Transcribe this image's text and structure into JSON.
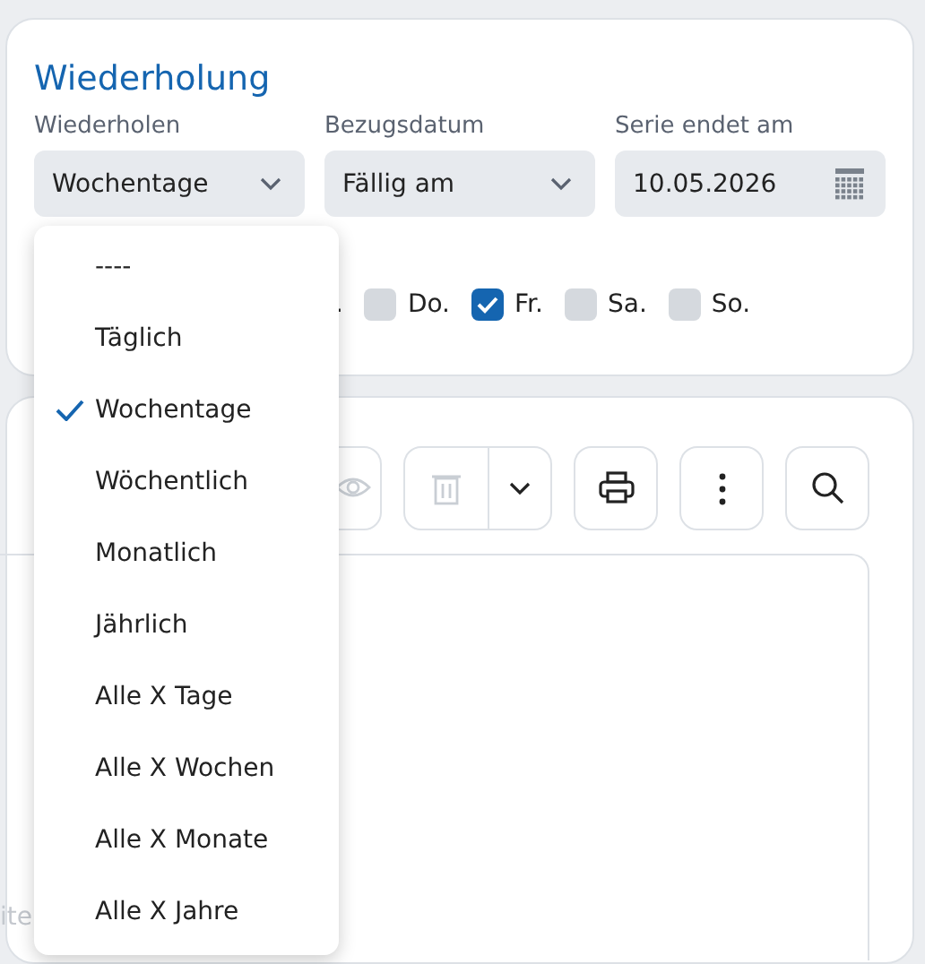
{
  "recurrence": {
    "title": "Wiederholung",
    "fields": [
      {
        "kind": "select",
        "label": "Wiederholen",
        "value": "Wochentage"
      },
      {
        "kind": "select",
        "label": "Bezugsdatum",
        "value": "Fällig am"
      },
      {
        "kind": "date",
        "label": "Serie endet am",
        "value": "10.05.2026"
      }
    ],
    "weekday_fragment": ".",
    "weekdays": [
      {
        "label": "Do.",
        "checked": false
      },
      {
        "label": "Fr.",
        "checked": true
      },
      {
        "label": "Sa.",
        "checked": false
      },
      {
        "label": "So.",
        "checked": false
      }
    ]
  },
  "toolbar": [
    {
      "kind": "view",
      "disabled": true
    },
    {
      "kind": "delete",
      "disabled": true
    },
    {
      "kind": "print",
      "disabled": false
    },
    {
      "kind": "more",
      "disabled": false
    },
    {
      "kind": "search",
      "disabled": false
    }
  ],
  "content": {
    "text_fragment": "ite"
  },
  "dropdown": {
    "options": [
      {
        "label": "----",
        "selected": false
      },
      {
        "label": "Täglich",
        "selected": false
      },
      {
        "label": "Wochentage",
        "selected": true
      },
      {
        "label": "Wöchentlich",
        "selected": false
      },
      {
        "label": "Monatlich",
        "selected": false
      },
      {
        "label": "Jährlich",
        "selected": false
      },
      {
        "label": "Alle X Tage",
        "selected": false
      },
      {
        "label": "Alle X Wochen",
        "selected": false
      },
      {
        "label": "Alle X Monate",
        "selected": false
      },
      {
        "label": "Alle X Jahre",
        "selected": false
      }
    ]
  }
}
